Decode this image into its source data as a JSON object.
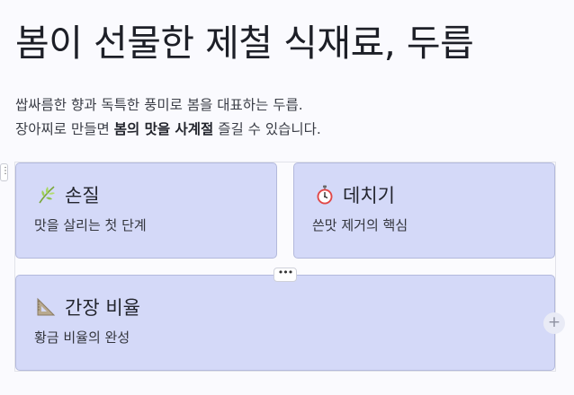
{
  "title": "봄이 선물한 제철 식재료, 두릅",
  "intro": {
    "line1": "쌉싸름한 향과 독특한 풍미로 봄을 대표하는 두릅.",
    "line2_prefix": "장아찌로 만들면 ",
    "line2_bold": "봄의 맛을 사계절",
    "line2_suffix": " 즐길 수 있습니다."
  },
  "cards": [
    {
      "title": "손질",
      "desc": "맛을 살리는 첫 단계",
      "icon": "herb-icon"
    },
    {
      "title": "데치기",
      "desc": "쓴맛 제거의 핵심",
      "icon": "stopwatch-icon"
    },
    {
      "title": "간장 비율",
      "desc": "황금 비율의 완성",
      "icon": "triangle-ruler-icon"
    }
  ],
  "controls": {
    "edge_handle": "⋮",
    "more": "•••",
    "add": "+"
  },
  "colors": {
    "card_bg": "#d4d9f8",
    "card_border": "#b3b9dc",
    "page_bg": "#fafafe"
  }
}
